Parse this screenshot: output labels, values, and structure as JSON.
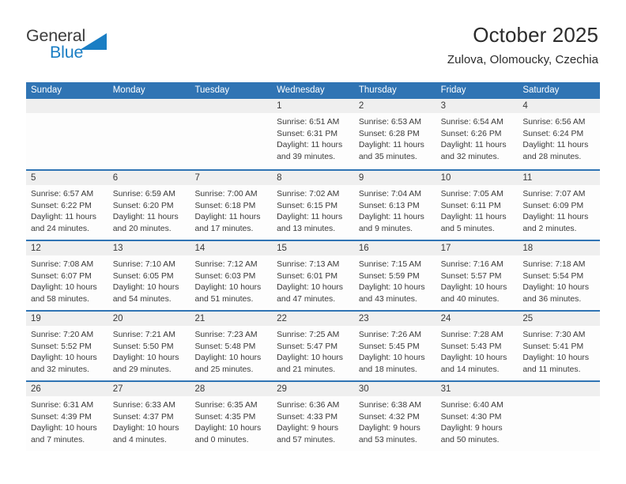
{
  "brand": {
    "name_part1": "General",
    "name_part2": "Blue",
    "triangle_color": "#1a7ec4",
    "text_color": "#3c3c3c"
  },
  "header": {
    "title": "October 2025",
    "subtitle": "Zulova, Olomoucky, Czechia"
  },
  "colors": {
    "header_blue": "#3074b4",
    "date_band": "#efefef",
    "text": "#3a3a3a",
    "accent": "#1a7ec4"
  },
  "weekdays": [
    "Sunday",
    "Monday",
    "Tuesday",
    "Wednesday",
    "Thursday",
    "Friday",
    "Saturday"
  ],
  "calendar": {
    "month": "October",
    "year": "2025",
    "location": "Zulova, Olomoucky, Czechia",
    "weeks": [
      [
        {
          "day": "",
          "sunrise": "",
          "sunset": "",
          "daylight_1": "",
          "daylight_2": ""
        },
        {
          "day": "",
          "sunrise": "",
          "sunset": "",
          "daylight_1": "",
          "daylight_2": ""
        },
        {
          "day": "",
          "sunrise": "",
          "sunset": "",
          "daylight_1": "",
          "daylight_2": ""
        },
        {
          "day": "1",
          "sunrise": "Sunrise: 6:51 AM",
          "sunset": "Sunset: 6:31 PM",
          "daylight_1": "Daylight: 11 hours",
          "daylight_2": "and 39 minutes."
        },
        {
          "day": "2",
          "sunrise": "Sunrise: 6:53 AM",
          "sunset": "Sunset: 6:28 PM",
          "daylight_1": "Daylight: 11 hours",
          "daylight_2": "and 35 minutes."
        },
        {
          "day": "3",
          "sunrise": "Sunrise: 6:54 AM",
          "sunset": "Sunset: 6:26 PM",
          "daylight_1": "Daylight: 11 hours",
          "daylight_2": "and 32 minutes."
        },
        {
          "day": "4",
          "sunrise": "Sunrise: 6:56 AM",
          "sunset": "Sunset: 6:24 PM",
          "daylight_1": "Daylight: 11 hours",
          "daylight_2": "and 28 minutes."
        }
      ],
      [
        {
          "day": "5",
          "sunrise": "Sunrise: 6:57 AM",
          "sunset": "Sunset: 6:22 PM",
          "daylight_1": "Daylight: 11 hours",
          "daylight_2": "and 24 minutes."
        },
        {
          "day": "6",
          "sunrise": "Sunrise: 6:59 AM",
          "sunset": "Sunset: 6:20 PM",
          "daylight_1": "Daylight: 11 hours",
          "daylight_2": "and 20 minutes."
        },
        {
          "day": "7",
          "sunrise": "Sunrise: 7:00 AM",
          "sunset": "Sunset: 6:18 PM",
          "daylight_1": "Daylight: 11 hours",
          "daylight_2": "and 17 minutes."
        },
        {
          "day": "8",
          "sunrise": "Sunrise: 7:02 AM",
          "sunset": "Sunset: 6:15 PM",
          "daylight_1": "Daylight: 11 hours",
          "daylight_2": "and 13 minutes."
        },
        {
          "day": "9",
          "sunrise": "Sunrise: 7:04 AM",
          "sunset": "Sunset: 6:13 PM",
          "daylight_1": "Daylight: 11 hours",
          "daylight_2": "and 9 minutes."
        },
        {
          "day": "10",
          "sunrise": "Sunrise: 7:05 AM",
          "sunset": "Sunset: 6:11 PM",
          "daylight_1": "Daylight: 11 hours",
          "daylight_2": "and 5 minutes."
        },
        {
          "day": "11",
          "sunrise": "Sunrise: 7:07 AM",
          "sunset": "Sunset: 6:09 PM",
          "daylight_1": "Daylight: 11 hours",
          "daylight_2": "and 2 minutes."
        }
      ],
      [
        {
          "day": "12",
          "sunrise": "Sunrise: 7:08 AM",
          "sunset": "Sunset: 6:07 PM",
          "daylight_1": "Daylight: 10 hours",
          "daylight_2": "and 58 minutes."
        },
        {
          "day": "13",
          "sunrise": "Sunrise: 7:10 AM",
          "sunset": "Sunset: 6:05 PM",
          "daylight_1": "Daylight: 10 hours",
          "daylight_2": "and 54 minutes."
        },
        {
          "day": "14",
          "sunrise": "Sunrise: 7:12 AM",
          "sunset": "Sunset: 6:03 PM",
          "daylight_1": "Daylight: 10 hours",
          "daylight_2": "and 51 minutes."
        },
        {
          "day": "15",
          "sunrise": "Sunrise: 7:13 AM",
          "sunset": "Sunset: 6:01 PM",
          "daylight_1": "Daylight: 10 hours",
          "daylight_2": "and 47 minutes."
        },
        {
          "day": "16",
          "sunrise": "Sunrise: 7:15 AM",
          "sunset": "Sunset: 5:59 PM",
          "daylight_1": "Daylight: 10 hours",
          "daylight_2": "and 43 minutes."
        },
        {
          "day": "17",
          "sunrise": "Sunrise: 7:16 AM",
          "sunset": "Sunset: 5:57 PM",
          "daylight_1": "Daylight: 10 hours",
          "daylight_2": "and 40 minutes."
        },
        {
          "day": "18",
          "sunrise": "Sunrise: 7:18 AM",
          "sunset": "Sunset: 5:54 PM",
          "daylight_1": "Daylight: 10 hours",
          "daylight_2": "and 36 minutes."
        }
      ],
      [
        {
          "day": "19",
          "sunrise": "Sunrise: 7:20 AM",
          "sunset": "Sunset: 5:52 PM",
          "daylight_1": "Daylight: 10 hours",
          "daylight_2": "and 32 minutes."
        },
        {
          "day": "20",
          "sunrise": "Sunrise: 7:21 AM",
          "sunset": "Sunset: 5:50 PM",
          "daylight_1": "Daylight: 10 hours",
          "daylight_2": "and 29 minutes."
        },
        {
          "day": "21",
          "sunrise": "Sunrise: 7:23 AM",
          "sunset": "Sunset: 5:48 PM",
          "daylight_1": "Daylight: 10 hours",
          "daylight_2": "and 25 minutes."
        },
        {
          "day": "22",
          "sunrise": "Sunrise: 7:25 AM",
          "sunset": "Sunset: 5:47 PM",
          "daylight_1": "Daylight: 10 hours",
          "daylight_2": "and 21 minutes."
        },
        {
          "day": "23",
          "sunrise": "Sunrise: 7:26 AM",
          "sunset": "Sunset: 5:45 PM",
          "daylight_1": "Daylight: 10 hours",
          "daylight_2": "and 18 minutes."
        },
        {
          "day": "24",
          "sunrise": "Sunrise: 7:28 AM",
          "sunset": "Sunset: 5:43 PM",
          "daylight_1": "Daylight: 10 hours",
          "daylight_2": "and 14 minutes."
        },
        {
          "day": "25",
          "sunrise": "Sunrise: 7:30 AM",
          "sunset": "Sunset: 5:41 PM",
          "daylight_1": "Daylight: 10 hours",
          "daylight_2": "and 11 minutes."
        }
      ],
      [
        {
          "day": "26",
          "sunrise": "Sunrise: 6:31 AM",
          "sunset": "Sunset: 4:39 PM",
          "daylight_1": "Daylight: 10 hours",
          "daylight_2": "and 7 minutes."
        },
        {
          "day": "27",
          "sunrise": "Sunrise: 6:33 AM",
          "sunset": "Sunset: 4:37 PM",
          "daylight_1": "Daylight: 10 hours",
          "daylight_2": "and 4 minutes."
        },
        {
          "day": "28",
          "sunrise": "Sunrise: 6:35 AM",
          "sunset": "Sunset: 4:35 PM",
          "daylight_1": "Daylight: 10 hours",
          "daylight_2": "and 0 minutes."
        },
        {
          "day": "29",
          "sunrise": "Sunrise: 6:36 AM",
          "sunset": "Sunset: 4:33 PM",
          "daylight_1": "Daylight: 9 hours",
          "daylight_2": "and 57 minutes."
        },
        {
          "day": "30",
          "sunrise": "Sunrise: 6:38 AM",
          "sunset": "Sunset: 4:32 PM",
          "daylight_1": "Daylight: 9 hours",
          "daylight_2": "and 53 minutes."
        },
        {
          "day": "31",
          "sunrise": "Sunrise: 6:40 AM",
          "sunset": "Sunset: 4:30 PM",
          "daylight_1": "Daylight: 9 hours",
          "daylight_2": "and 50 minutes."
        },
        {
          "day": "",
          "sunrise": "",
          "sunset": "",
          "daylight_1": "",
          "daylight_2": ""
        }
      ]
    ]
  }
}
